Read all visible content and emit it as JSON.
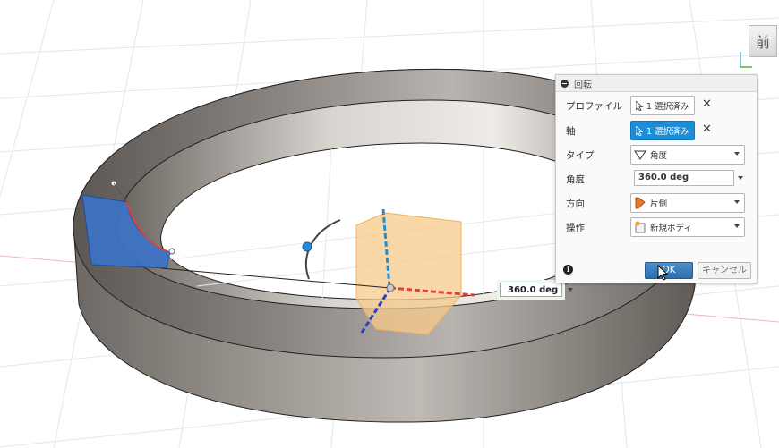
{
  "viewcube": {
    "face_label": "前"
  },
  "dialog": {
    "title": "回転",
    "rows": {
      "profile": {
        "label": "プロファイル",
        "value": "1 選択済み"
      },
      "axis": {
        "label": "軸",
        "value": "1 選択済み"
      },
      "type": {
        "label": "タイプ",
        "value": "角度",
        "icon": "angle-icon"
      },
      "angle": {
        "label": "角度",
        "value": "360.0 deg"
      },
      "direction": {
        "label": "方向",
        "value": "片側",
        "icon": "one-side-icon"
      },
      "operation": {
        "label": "操作",
        "value": "新規ボディ",
        "icon": "new-body-icon"
      }
    },
    "ok_label": "OK",
    "cancel_label": "キャンセル"
  },
  "viewport": {
    "angle_input_value": "360.0 deg"
  },
  "colors": {
    "selection_blue": "#1c8ed8",
    "ring_metal": "#8b8580",
    "preview_orange": "#f7c98a"
  }
}
